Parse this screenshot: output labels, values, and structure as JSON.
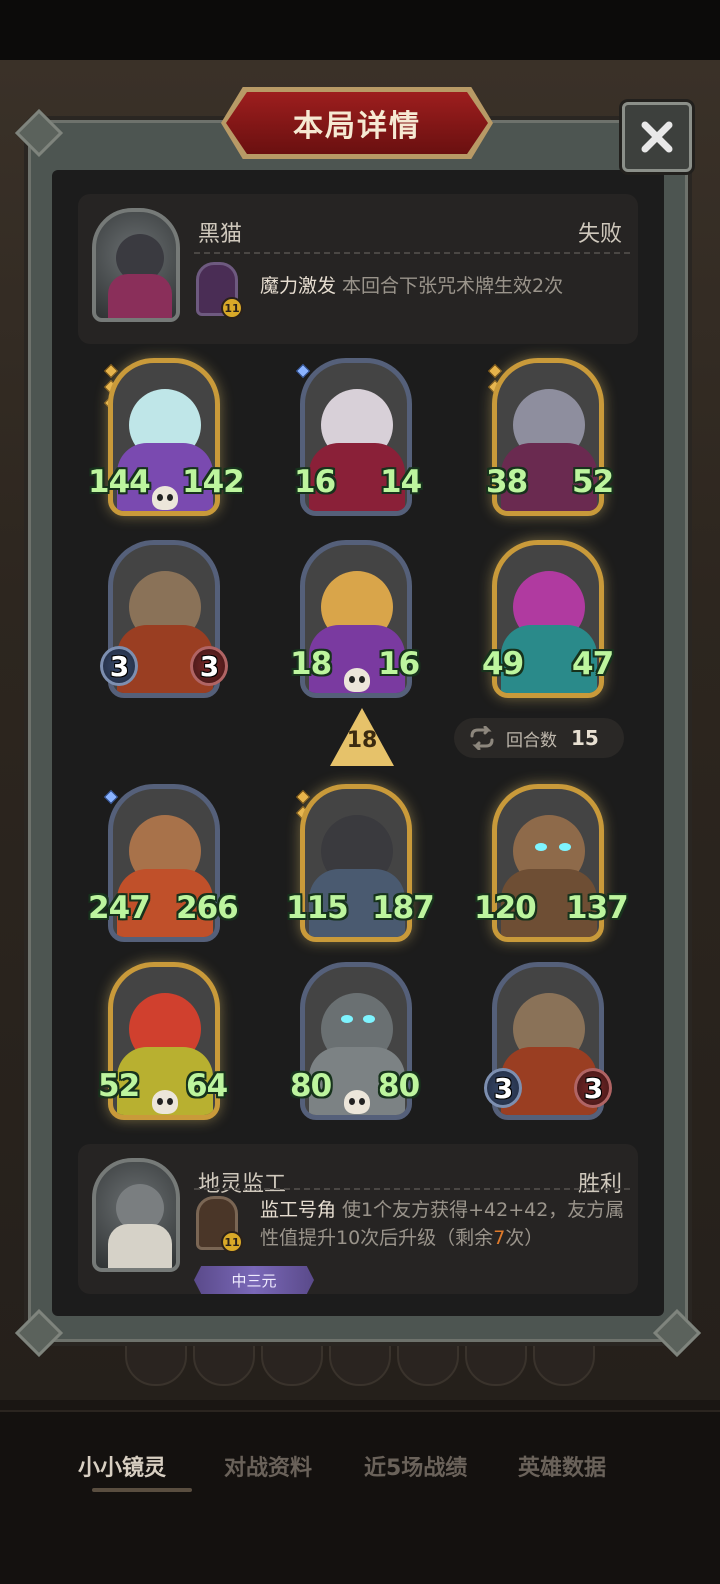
{
  "dialog": {
    "title": "本局详情"
  },
  "opponent": {
    "name": "黑猫",
    "result": "失败",
    "item_level": "11",
    "skill_name": "魔力激发",
    "skill_desc": "本回合下张咒术牌生效2次"
  },
  "player": {
    "name": "地灵监工",
    "result": "胜利",
    "item_level": "11",
    "skill_name": "监工号角",
    "skill_desc_1": "使1个友方获得+42+42，友方属",
    "skill_desc_2_a": "性值提升10次后升级（剩余",
    "skill_desc_2_hl": "7",
    "skill_desc_2_b": "次）",
    "tag": "中三元"
  },
  "opponent_board": [
    {
      "atk": "144",
      "hp": "142",
      "gold": true,
      "skull": true,
      "style": "circle-none"
    },
    {
      "atk": "16",
      "hp": "14",
      "gold": false,
      "skull": false
    },
    {
      "atk": "38",
      "hp": "52",
      "gold": true,
      "skull": false
    },
    {
      "atk": "3",
      "hp": "3",
      "gold": false,
      "skull": false
    },
    {
      "atk": "18",
      "hp": "16",
      "gold": false,
      "skull": true
    },
    {
      "atk": "49",
      "hp": "47",
      "gold": true,
      "skull": false
    }
  ],
  "player_board": [
    {
      "atk": "247",
      "hp": "266",
      "gold": false,
      "skull": false
    },
    {
      "atk": "115",
      "hp": "187",
      "gold": true,
      "skull": false
    },
    {
      "atk": "120",
      "hp": "137",
      "gold": true,
      "skull": false
    },
    {
      "atk": "52",
      "hp": "64",
      "gold": true,
      "skull": true
    },
    {
      "atk": "80",
      "hp": "80",
      "gold": false,
      "skull": true
    },
    {
      "atk": "3",
      "hp": "3",
      "gold": false,
      "skull": false
    }
  ],
  "tavern_tier": "18",
  "round": {
    "label": "回合数",
    "value": "15"
  },
  "bottom_nav": {
    "tabs": [
      "小小镜灵",
      "对战资料",
      "近5场战绩",
      "英雄数据"
    ]
  },
  "colors": {
    "stat_green": "#bdf59e",
    "banner_red": "#9d1e1e",
    "gold_frame": "#c99a3a",
    "highlight_orange": "#e07a2a"
  }
}
